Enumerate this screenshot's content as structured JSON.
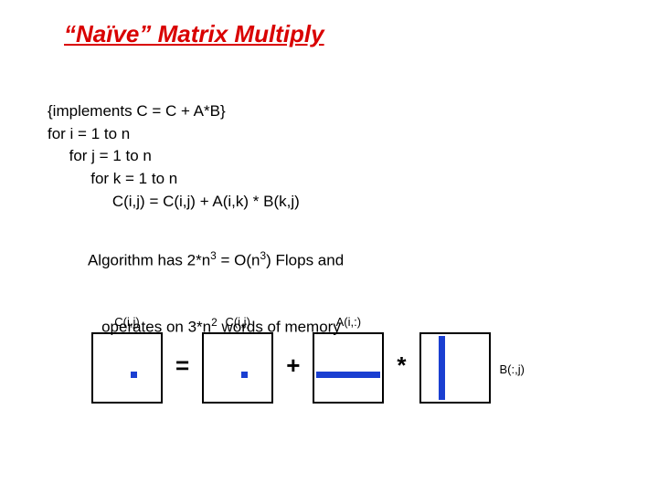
{
  "title": "“Naïve” Matrix Multiply",
  "code": {
    "l1": "{implements C = C + A*B}",
    "l2": "for i = 1 to n",
    "l3": "     for j = 1 to n",
    "l4": "          for k = 1 to n",
    "l5": "               C(i,j) = C(i,j) + A(i,k) * B(k,j)"
  },
  "algo": {
    "pre1": "Algorithm has 2*n",
    "exp1": "3",
    "mid1": " = O(n",
    "exp2": "3",
    "post1": ") Flops and",
    "pre2": "   operates on 3*n",
    "exp3": "2",
    "post2": " words of memory"
  },
  "labels": {
    "c1": "C(i,j)",
    "c2": "C(i,j)",
    "a": "A(i,:)",
    "b": "B(:,j)"
  },
  "ops": {
    "eq": "=",
    "plus": "+",
    "times": "*"
  }
}
